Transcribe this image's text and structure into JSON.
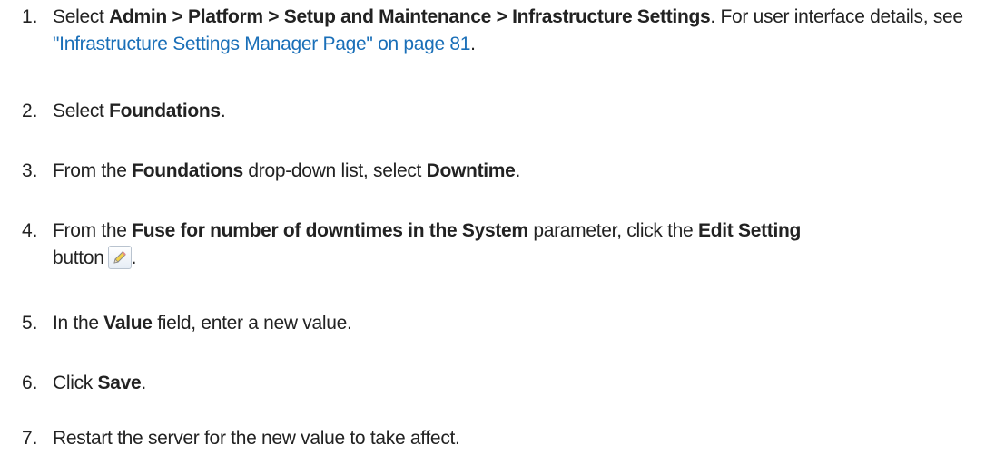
{
  "steps": [
    {
      "num": "1.",
      "select": "Select",
      "path": "Admin > Platform > Setup and Maintenance > Infrastructure Settings",
      "after_path": ". For user interface details, see ",
      "link": "\"Infrastructure Settings Manager Page\" on page 81",
      "end": "."
    },
    {
      "num": "2.",
      "select": "Select",
      "item": "Foundations",
      "end": "."
    },
    {
      "num": "3.",
      "from": "From the",
      "list": "Foundations",
      "mid": "drop-down list, select",
      "item": "Downtime",
      "end": "."
    },
    {
      "num": "4.",
      "from": "From the",
      "param": "Fuse for number of downtimes in the System",
      "mid": "parameter, click the",
      "button": "Edit Setting",
      "button_word": "button",
      "icon": "pencil-icon",
      "end": "."
    },
    {
      "num": "5.",
      "in": "In the",
      "field": "Value",
      "end": "field, enter a new value."
    },
    {
      "num": "6.",
      "click": "Click",
      "item": "Save",
      "end": "."
    },
    {
      "num": "7.",
      "text": "Restart the server for the new value to take affect."
    }
  ]
}
